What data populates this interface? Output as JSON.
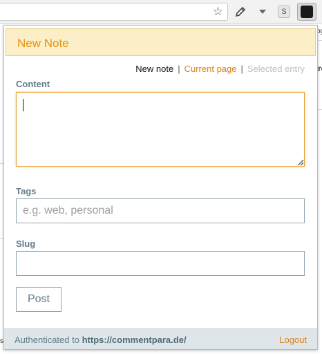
{
  "popup": {
    "title": "New Note",
    "modes": {
      "new_note": "New note",
      "current_page": "Current page",
      "selected_entry": "Selected entry",
      "separator": "|"
    },
    "content": {
      "label": "Content",
      "value": ""
    },
    "tags": {
      "label": "Tags",
      "placeholder": "e.g. web, personal",
      "value": ""
    },
    "slug": {
      "label": "Slug",
      "value": ""
    },
    "post_label": "Post",
    "footer": {
      "auth_prefix": "Authenticated to",
      "auth_url": "https://commentpara.de/",
      "logout": "Logout"
    }
  },
  "toolbar": {
    "star_glyph": "☆",
    "s_extension_glyph": "S"
  },
  "background_page": {
    "fragment_top": "og",
    "fragment_mid": "re",
    "fragment_bottom": "s"
  },
  "colors": {
    "accent": "#e07d10",
    "header_bg": "#fcefc7",
    "label": "#607d8b",
    "footer_bg": "#dfe6ea"
  }
}
